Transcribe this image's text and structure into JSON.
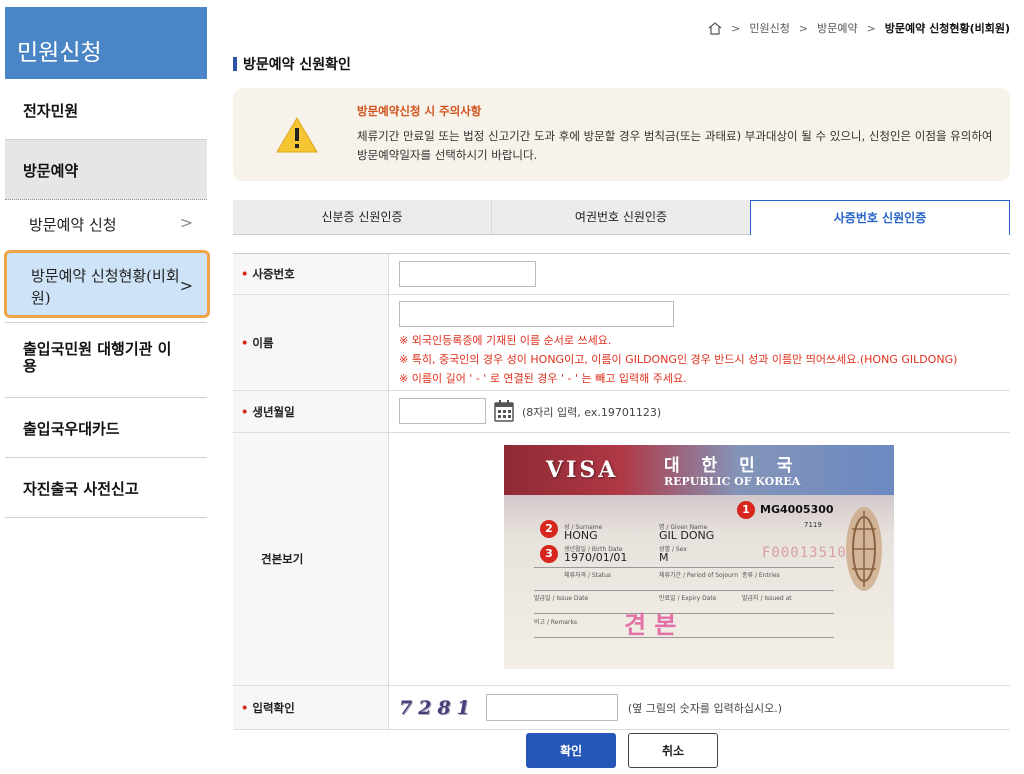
{
  "sidebar": {
    "header": "민원신청",
    "items": [
      {
        "label": "전자민원"
      },
      {
        "label": "방문예약"
      },
      {
        "label": "방문예약 신청"
      },
      {
        "label": "방문예약 신청현황(비회원)"
      },
      {
        "label": "출입국민원 대행기관 이용"
      },
      {
        "label": "출입국우대카드"
      },
      {
        "label": "자진출국 사전신고"
      }
    ]
  },
  "breadcrumb": [
    "민원신청",
    "방문예약",
    "방문예약 신청현황(비회원)"
  ],
  "page_title": "방문예약 신원확인",
  "notice": {
    "title": "방문예약신청 시 주의사항",
    "body": "체류기간 만료일 또는 법정 신고기간 도과 후에 방문할 경우 범칙금(또는 과태료) 부과대상이 될 수 있으니, 신청인은 이점을 유의하여 방문예약일자를 선택하시기 바랍니다."
  },
  "tabs": [
    {
      "label": "신분증 신원인증",
      "active": false
    },
    {
      "label": "여권번호 신원인증",
      "active": false
    },
    {
      "label": "사증번호 신원인증",
      "active": true
    }
  ],
  "form": {
    "visa_number_label": "사증번호",
    "name_label": "이름",
    "name_hints": [
      "※ 외국인등록증에 기재된 이름 순서로 쓰세요.",
      "※ 특히, 중국인의 경우 성이 HONG이고, 이름이 GILDONG인 경우 반드시 성과 이름만 띄어쓰세요.(HONG GILDONG)",
      "※ 이름이 길어 ' - ' 로 연결된 경우 ' - ' 는 빼고 입력해 주세요."
    ],
    "birth_label": "생년월일",
    "birth_hint": "(8자리 입력, ex.19701123)",
    "sample_label": "견본보기",
    "captcha_label": "입력확인",
    "captcha_value": "7281",
    "captcha_hint": "(옆 그림의 숫자를 입력하십시오.)"
  },
  "visa_sample": {
    "word": "VISA",
    "country_kor": "대 한 민 국",
    "country_eng": "REPUBLIC OF KOREA",
    "number": "MG4005300",
    "code": "7119",
    "surname_caption": "성 / Surname",
    "given_caption": "명 / Given Name",
    "surname": "HONG",
    "given_name": "GIL DONG",
    "birth_caption": "생년월일 / Birth Date",
    "sex_caption": "성별 / Sex",
    "birth": "1970/01/01",
    "sex": "M",
    "status_caption": "체류자격 / Status",
    "sojourn_caption": "체류기간 / Period of Sojourn",
    "entries_caption": "종류 / Entries",
    "issue_caption": "발급일 / Issue Date",
    "expiry_caption": "만료일 / Expiry Date",
    "issued_at_caption": "발급지 / Issued at",
    "remarks_caption": "비고 / Remarks",
    "serial": "F00013510",
    "stamp": "견  본",
    "badges": [
      "1",
      "2",
      "3"
    ]
  },
  "buttons": {
    "confirm": "확인",
    "cancel": "취소"
  },
  "colors": {
    "sidebar_header": "#4a86c5",
    "active_tab": "#2563c9",
    "primary_button": "#2556b8",
    "hint_red": "#e0301e",
    "highlight_border": "#f0a44a"
  }
}
